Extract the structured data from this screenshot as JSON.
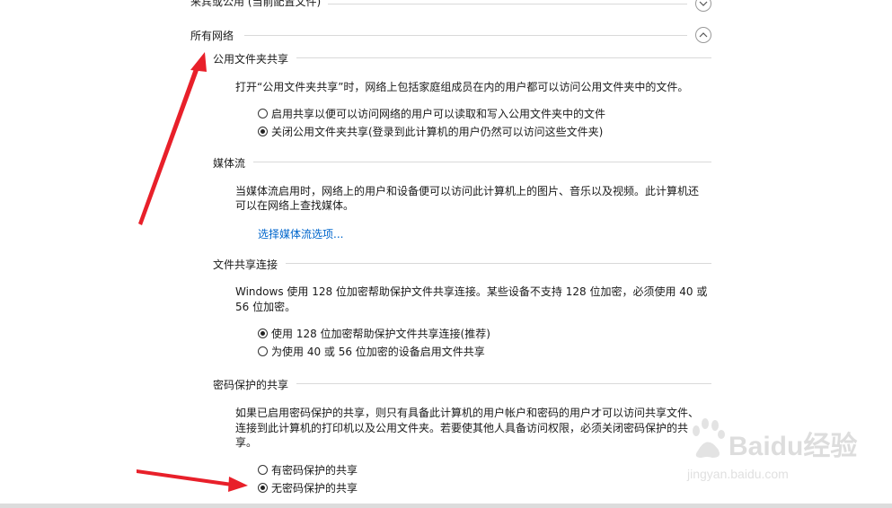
{
  "sections": {
    "top_cut_header": "来宾或公用 (当前配置文件)",
    "all_networks": "所有网络"
  },
  "public_folder": {
    "title": "公用文件夹共享",
    "desc": "打开“公用文件夹共享”时，网络上包括家庭组成员在内的用户都可以访问公用文件夹中的文件。",
    "options": [
      {
        "label": "启用共享以便可以访问网络的用户可以读取和写入公用文件夹中的文件",
        "checked": false
      },
      {
        "label": "关闭公用文件夹共享(登录到此计算机的用户仍然可以访问这些文件夹)",
        "checked": true
      }
    ]
  },
  "media": {
    "title": "媒体流",
    "desc_line1": "当媒体流启用时，网络上的用户和设备便可以访问此计算机上的图片、音乐以及视频。此计算机还",
    "desc_line2": "可以在网络上查找媒体。",
    "link": "选择媒体流选项..."
  },
  "file_sharing": {
    "title": "文件共享连接",
    "desc_line1": "Windows 使用 128 位加密帮助保护文件共享连接。某些设备不支持 128 位加密，必须使用 40 或",
    "desc_line2": "56 位加密。",
    "options": [
      {
        "label": "使用 128 位加密帮助保护文件共享连接(推荐)",
        "checked": true
      },
      {
        "label": "为使用 40 或 56 位加密的设备启用文件共享",
        "checked": false
      }
    ]
  },
  "password": {
    "title": "密码保护的共享",
    "desc_line1": "如果已启用密码保护的共享，则只有具备此计算机的用户帐户和密码的用户才可以访问共享文件、",
    "desc_line2": "连接到此计算机的打印机以及公用文件夹。若要使其他人具备访问权限，必须关闭密码保护的共",
    "desc_line3": "享。",
    "options": [
      {
        "label": "有密码保护的共享",
        "checked": false
      },
      {
        "label": "无密码保护的共享",
        "checked": true
      }
    ]
  },
  "watermark": {
    "brand": "Baidu经验",
    "url": "jingyan.baidu.com"
  },
  "colors": {
    "annotation_arrow": "#e8202a",
    "link": "#0066cc"
  }
}
